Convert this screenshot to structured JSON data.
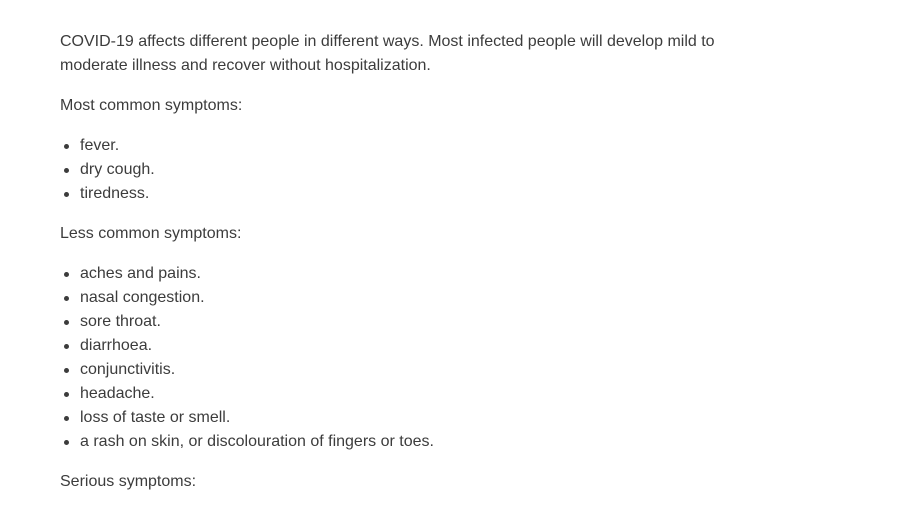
{
  "intro": "COVID-19 affects different people in different ways. Most infected people will develop mild to moderate illness and recover without hospitalization.",
  "most_common": {
    "heading": "Most common symptoms:",
    "items": [
      "fever.",
      "dry cough.",
      "tiredness."
    ]
  },
  "less_common": {
    "heading": "Less common symptoms:",
    "items": [
      "aches and pains.",
      "nasal congestion.",
      "sore throat.",
      "diarrhoea.",
      "conjunctivitis.",
      "headache.",
      "loss of taste or smell.",
      "a rash on skin, or discolouration of fingers or toes."
    ]
  },
  "serious": {
    "heading": "Serious symptoms:"
  }
}
